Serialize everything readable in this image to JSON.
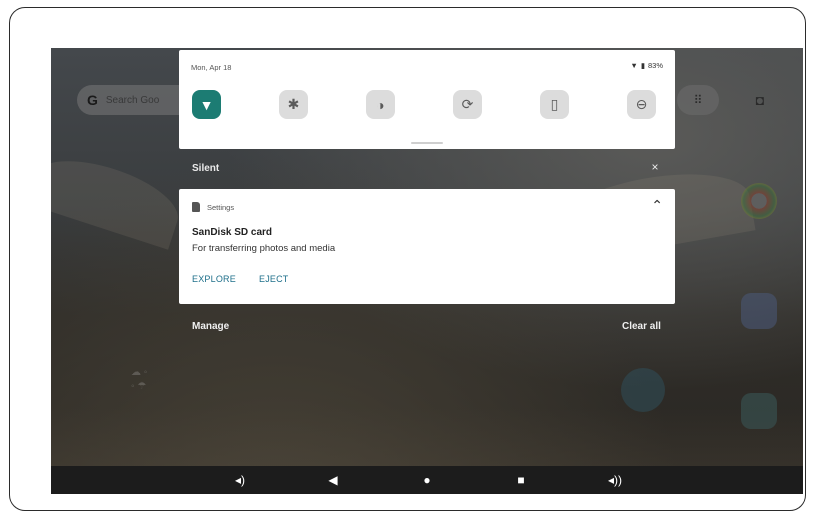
{
  "home": {
    "search_glyph": "G",
    "search_hint": "Search Goo",
    "apps_icon": "apps-grid-icon",
    "camera_icon": "camera-icon"
  },
  "quick_settings": {
    "date": "Mon, Apr 18",
    "battery_percent": "83%",
    "status_icons": [
      "wifi-icon",
      "battery-icon"
    ],
    "tiles": [
      {
        "name": "wifi",
        "icon": "wifi-icon",
        "glyph": "▼",
        "active": true
      },
      {
        "name": "bluetooth",
        "icon": "bluetooth-icon",
        "glyph": "✱",
        "active": false
      },
      {
        "name": "dark-theme",
        "icon": "contrast-icon",
        "glyph": "◑",
        "active": false
      },
      {
        "name": "auto-rotate",
        "icon": "rotate-icon",
        "glyph": "⟳",
        "active": false
      },
      {
        "name": "battery-saver",
        "icon": "battery-saver-icon",
        "glyph": "▯",
        "active": false
      },
      {
        "name": "do-not-disturb",
        "icon": "do-not-disturb-icon",
        "glyph": "⊖",
        "active": false
      }
    ],
    "active_color": "#1c7c73"
  },
  "silent_section": {
    "label": "Silent",
    "dismiss_glyph": "×"
  },
  "notification": {
    "app_name": "Settings",
    "title": "SanDisk SD card",
    "body": "For transferring photos and media",
    "collapse_glyph": "⌃",
    "actions": [
      "EXPLORE",
      "EJECT"
    ],
    "action_color": "#1e6f8a"
  },
  "footer": {
    "manage": "Manage",
    "clear_all": "Clear all"
  },
  "navbar": {
    "buttons": [
      {
        "name": "volume-down",
        "glyph": "🔈"
      },
      {
        "name": "back",
        "glyph": "◀"
      },
      {
        "name": "home",
        "glyph": "●"
      },
      {
        "name": "recents",
        "glyph": "■"
      },
      {
        "name": "volume-up",
        "glyph": "🔊"
      }
    ]
  }
}
